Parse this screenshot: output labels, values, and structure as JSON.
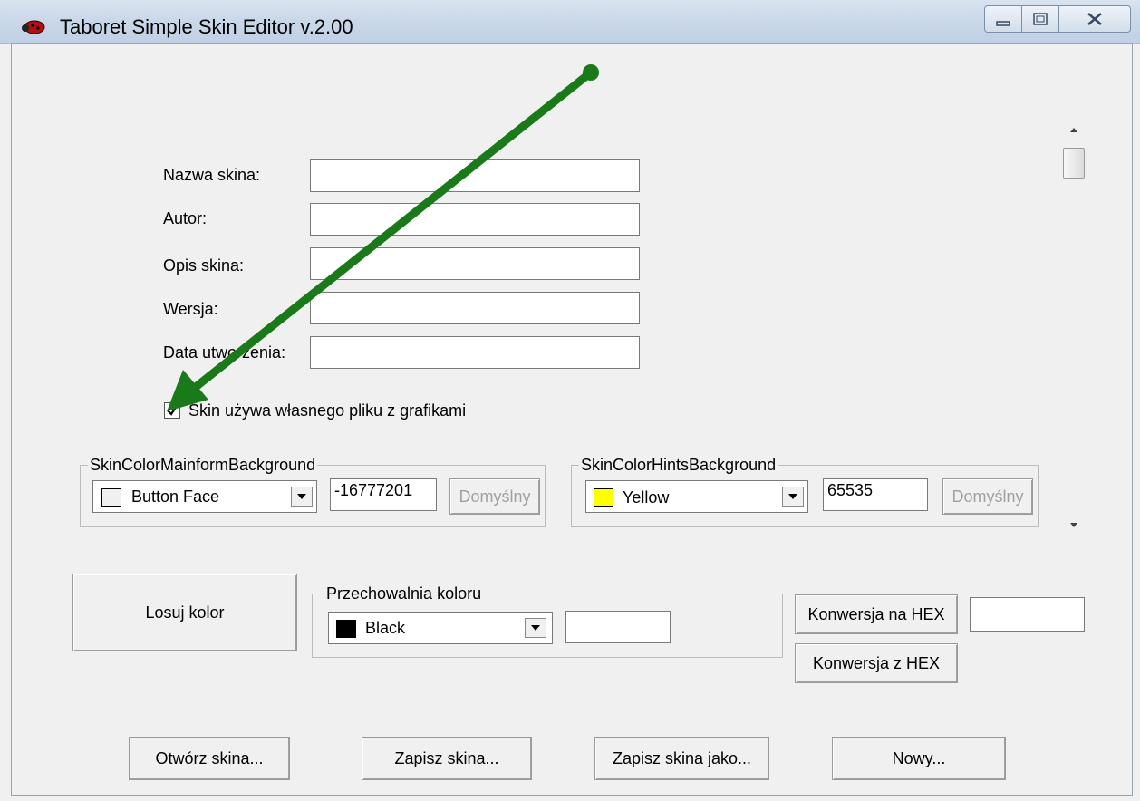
{
  "window": {
    "title": "Taboret Simple Skin Editor v.2.00"
  },
  "form": {
    "skin_name_label": "Nazwa skina:",
    "author_label": "Autor:",
    "description_label": "Opis skina:",
    "version_label": "Wersja:",
    "created_label": "Data utworzenia:",
    "skin_name_value": "",
    "author_value": "",
    "description_value": "",
    "version_value": "",
    "created_value": "",
    "own_graphics_checkbox_label": "Skin używa własnego pliku z grafikami",
    "own_graphics_checked": true
  },
  "mainform_group": {
    "title": "SkinColorMainformBackground",
    "selected_color": "Button Face",
    "swatch_color": "#f0f0f0",
    "value": "-16777201",
    "default_button": "Domyślny"
  },
  "hints_group": {
    "title": "SkinColorHintsBackground",
    "selected_color": "Yellow",
    "swatch_color": "#ffff00",
    "value": "65535",
    "default_button": "Domyślny"
  },
  "random_color_button": "Losuj kolor",
  "storage_group": {
    "title": "Przechowalnia koloru",
    "selected_color": "Black",
    "swatch_color": "#000000",
    "value": ""
  },
  "hex": {
    "to_hex_button": "Konwersja na HEX",
    "from_hex_button": "Konwersja z HEX",
    "hex_value": ""
  },
  "footer": {
    "open_button": "Otwórz skina...",
    "save_button": "Zapisz skina...",
    "save_as_button": "Zapisz skina jako...",
    "new_button": "Nowy..."
  },
  "annotation": {
    "arrow_color": "#1a7a1a"
  }
}
